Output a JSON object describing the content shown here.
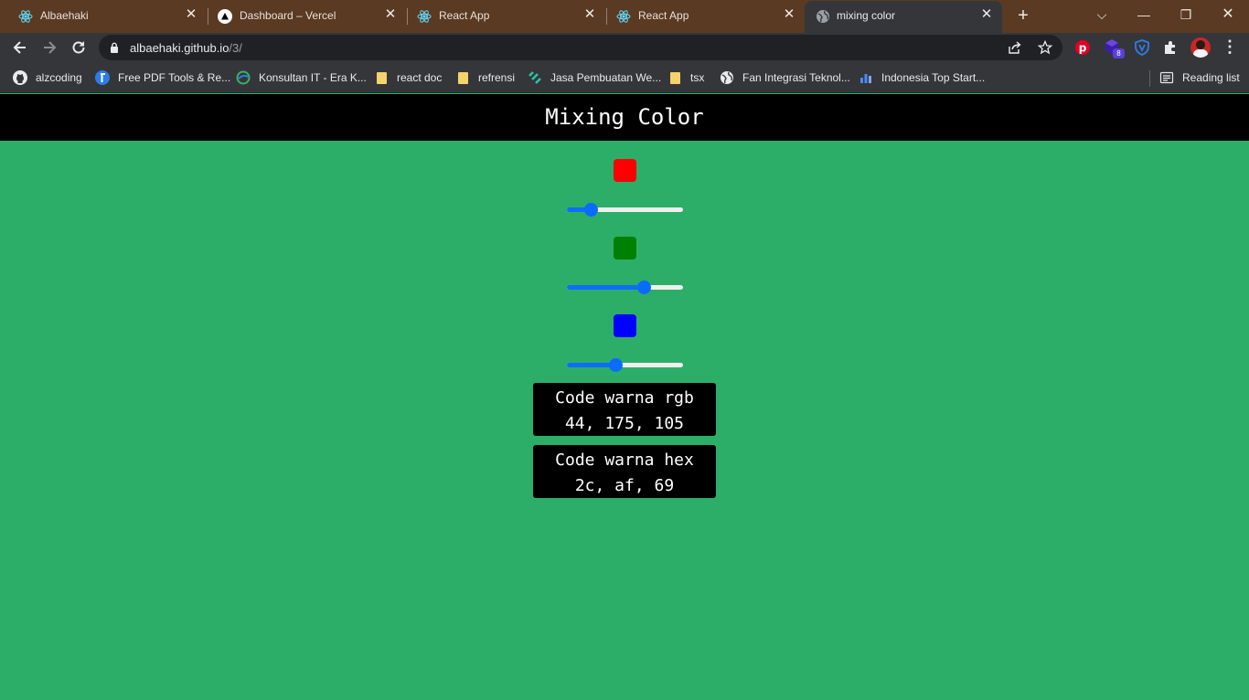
{
  "browser": {
    "tabs": [
      {
        "title": "Albaehaki",
        "icon": "react-icon"
      },
      {
        "title": "Dashboard – Vercel",
        "icon": "vercel-icon"
      },
      {
        "title": "React App",
        "icon": "react-icon"
      },
      {
        "title": "React App",
        "icon": "react-icon"
      },
      {
        "title": "mixing color",
        "icon": "globe-icon",
        "active": true
      }
    ],
    "url": {
      "host": "albaehaki.github.io",
      "path": "/3/"
    },
    "extension_badge": "8",
    "bookmarks": [
      {
        "label": "alzcoding",
        "icon": "github-icon"
      },
      {
        "label": "Free PDF Tools & Re...",
        "icon": "pdf-tool-icon"
      },
      {
        "label": "Konsultan IT - Era K...",
        "icon": "site-icon"
      },
      {
        "label": "react doc",
        "icon": "folder-icon"
      },
      {
        "label": "refrensi",
        "icon": "folder-icon"
      },
      {
        "label": "Jasa Pembuatan We...",
        "icon": "site-icon"
      },
      {
        "label": "tsx",
        "icon": "folder-icon"
      },
      {
        "label": "Fan Integrasi Teknol...",
        "icon": "globe-icon"
      },
      {
        "label": "Indonesia Top Start...",
        "icon": "chart-icon"
      }
    ],
    "reading_list": "Reading list"
  },
  "page": {
    "title": "Mixing Color",
    "background": "#2cae69",
    "sliders": [
      {
        "channel": "red",
        "swatch_color": "#ff0000",
        "value": 44,
        "max": 255
      },
      {
        "channel": "green",
        "swatch_color": "#008000",
        "value": 175,
        "max": 255
      },
      {
        "channel": "blue",
        "swatch_color": "#0000ff",
        "value": 105,
        "max": 255
      }
    ],
    "rgb_box": {
      "label": "Code warna rgb",
      "value": "44, 175, 105"
    },
    "hex_box": {
      "label": "Code warna hex",
      "value": "2c, af, 69"
    }
  }
}
